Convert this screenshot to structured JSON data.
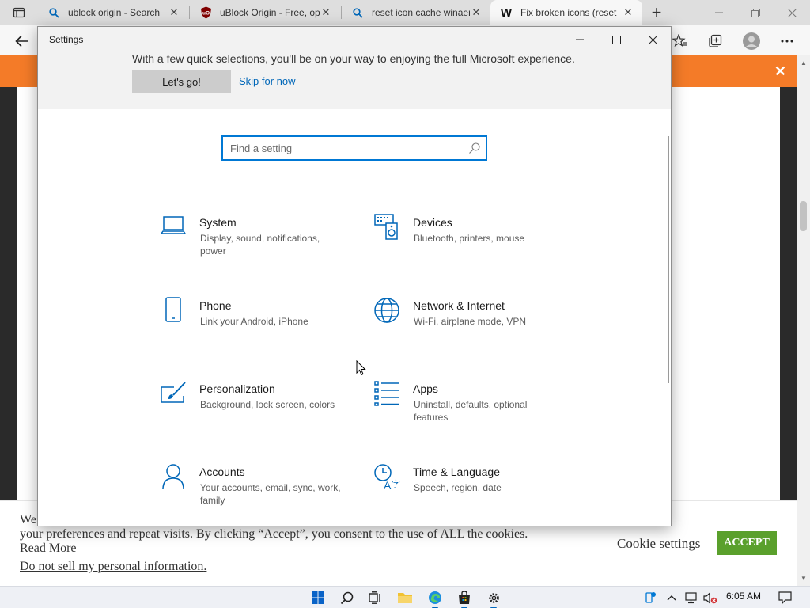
{
  "browser": {
    "tabs": [
      {
        "title": "ublock origin - Search",
        "icon": "search-icon"
      },
      {
        "title": "uBlock Origin - Free, op",
        "icon": "ublock-icon"
      },
      {
        "title": "reset icon cache winaer",
        "icon": "search-icon"
      },
      {
        "title": "Fix broken icons (reset",
        "icon": "winaero-icon",
        "favicon_text": "W"
      }
    ],
    "new_tab_label": "+",
    "banner_close": "✕"
  },
  "settings": {
    "window_title": "Settings",
    "banner_text": "With a few quick selections, you'll be on your way to enjoying the full Microsoft experience.",
    "lets_go_label": "Let's go!",
    "skip_label": "Skip for now",
    "search_placeholder": "Find a setting",
    "accent_color": "#0067b8",
    "categories": [
      {
        "name": "System",
        "desc": "Display, sound, notifications, power",
        "icon": "laptop-icon"
      },
      {
        "name": "Devices",
        "desc": "Bluetooth, printers, mouse",
        "icon": "devices-icon"
      },
      {
        "name": "Phone",
        "desc": "Link your Android, iPhone",
        "icon": "phone-icon"
      },
      {
        "name": "Network & Internet",
        "desc": "Wi-Fi, airplane mode, VPN",
        "icon": "globe-icon"
      },
      {
        "name": "Personalization",
        "desc": "Background, lock screen, colors",
        "icon": "paintbrush-icon"
      },
      {
        "name": "Apps",
        "desc": "Uninstall, defaults, optional features",
        "icon": "apps-list-icon"
      },
      {
        "name": "Accounts",
        "desc": "Your accounts, email, sync, work, family",
        "icon": "person-icon"
      },
      {
        "name": "Time & Language",
        "desc": "Speech, region, date",
        "icon": "time-language-icon"
      }
    ]
  },
  "cookie_banner": {
    "text_line1": "We",
    "text_body": "your preferences and repeat visits. By clicking “Accept”, you consent to the use of ALL the cookies.",
    "read_more": "Read More",
    "do_not_sell": "Do not sell my personal information",
    "settings_label": "Cookie settings",
    "accept_label": "ACCEPT",
    "accept_color": "#5aa02c"
  },
  "taskbar": {
    "time": "6:05 AM"
  },
  "colors": {
    "orange_banner": "#f47b28"
  }
}
